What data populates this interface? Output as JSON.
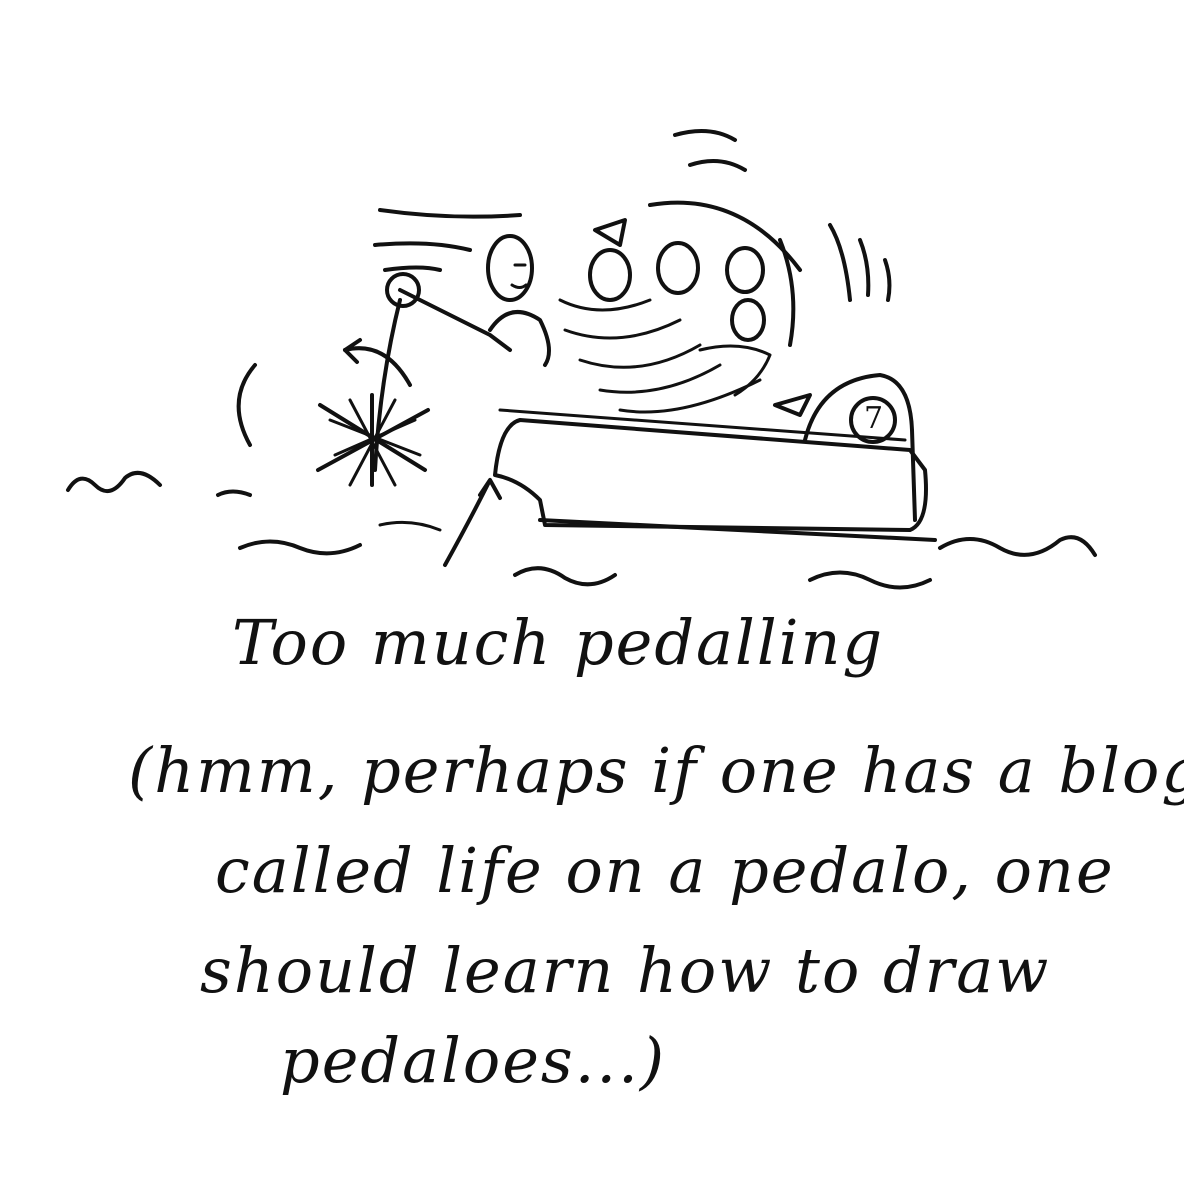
{
  "caption": {
    "line1": "Too much pedalling",
    "line2": "(hmm, perhaps if one has a blog",
    "line3": "called life on a pedalo, one",
    "line4": "should learn how to draw",
    "line5": "pedaloes...)"
  },
  "boat": {
    "number": "7"
  },
  "colors": {
    "ink": "#111111",
    "paper": "#ffffff"
  }
}
